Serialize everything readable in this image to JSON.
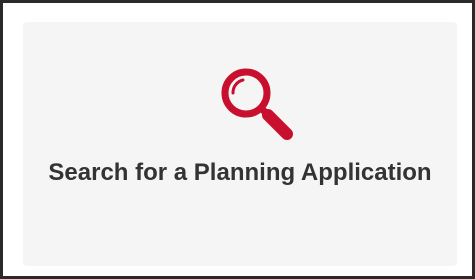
{
  "tile": {
    "label": "Search for a Planning Application",
    "icon": "search-icon",
    "accent_color": "#c8102e",
    "text_color": "#333333",
    "background_color": "#f5f5f5"
  }
}
